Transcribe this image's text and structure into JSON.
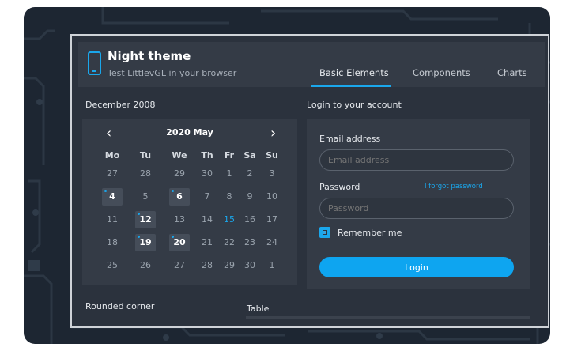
{
  "header": {
    "title": "Night theme",
    "subtitle": "Test LittlevGL in your browser",
    "tabs": [
      "Basic Elements",
      "Components",
      "Charts"
    ],
    "active_tab": "Basic Elements"
  },
  "calendar": {
    "section_title": "December 2008",
    "month_label": "2020 May",
    "prev_icon": "‹",
    "next_icon": "›",
    "weekdays": [
      "Mo",
      "Tu",
      "We",
      "Th",
      "Fr",
      "Sa",
      "Su"
    ],
    "weeks": [
      [
        "27",
        "28",
        "29",
        "30",
        "1",
        "2",
        "3"
      ],
      [
        "4",
        "5",
        "6",
        "7",
        "8",
        "9",
        "10"
      ],
      [
        "11",
        "12",
        "13",
        "14",
        "15",
        "16",
        "17"
      ],
      [
        "18",
        "19",
        "20",
        "21",
        "22",
        "23",
        "24"
      ],
      [
        "25",
        "26",
        "27",
        "28",
        "29",
        "30",
        "1"
      ]
    ],
    "highlighted_days": [
      "4",
      "6",
      "12",
      "19",
      "20"
    ],
    "today": "15"
  },
  "login": {
    "section_title": "Login to your account",
    "email_label": "Email address",
    "email_placeholder": "Email address",
    "password_label": "Password",
    "password_placeholder": "Password",
    "forgot_link": "I forgot password",
    "remember_label": "Remember me",
    "remember_checked": true,
    "button_label": "Login"
  },
  "bottom": {
    "rounded_corner_title": "Rounded corner",
    "table_title": "Table"
  },
  "colors": {
    "accent": "#0ea5f0",
    "panel": "#343b46",
    "background": "#2b323d"
  }
}
